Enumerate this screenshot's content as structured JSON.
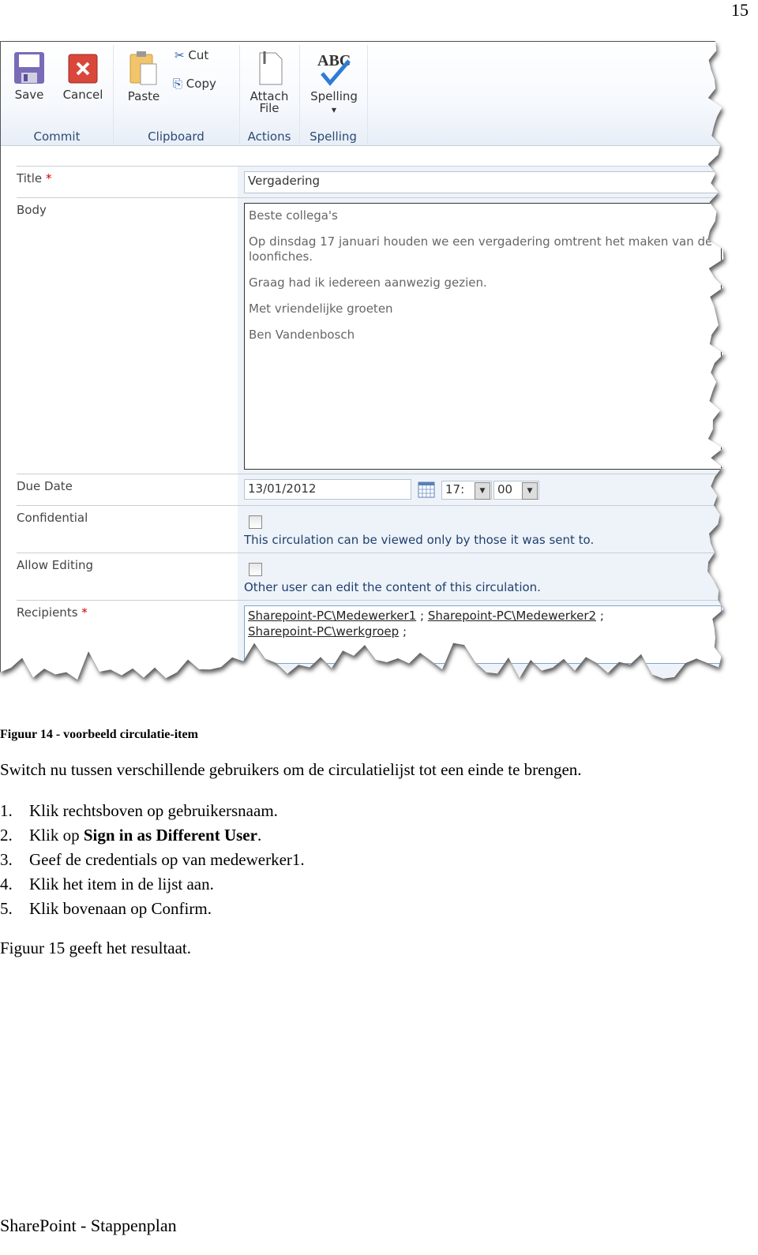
{
  "page_number": "15",
  "screenshot": {
    "ribbon": {
      "groups": [
        {
          "label": "Commit",
          "buttons": [
            "Save",
            "Cancel"
          ]
        },
        {
          "label": "Clipboard",
          "buttons": [
            "Paste",
            "Cut",
            "Copy"
          ]
        },
        {
          "label": "Actions",
          "buttons": [
            "Attach File"
          ]
        },
        {
          "label": "Spelling",
          "buttons": [
            "Spelling"
          ]
        }
      ]
    },
    "form": {
      "title": {
        "label": "Title",
        "required": "*",
        "value": "Vergadering"
      },
      "body": {
        "label": "Body",
        "paragraphs": [
          "Beste collega's",
          "Op dinsdag 17 januari houden we een vergadering omtrent het maken van de loonfiches.",
          "Graag had ik iedereen aanwezig gezien.",
          "Met vriendelijke groeten",
          "Ben Vandenbosch"
        ]
      },
      "due_date": {
        "label": "Due Date",
        "date": "13/01/2012",
        "hour": "17:",
        "minute": "00"
      },
      "confidential": {
        "label": "Confidential",
        "checked": false,
        "hint": "This circulation can be viewed only by those it was sent to."
      },
      "allow_editing": {
        "label": "Allow Editing",
        "checked": false,
        "hint": "Other user can edit the content of this circulation."
      },
      "recipients": {
        "label": "Recipients",
        "required": "*",
        "values": [
          "Sharepoint-PC\\Medewerker1",
          "Sharepoint-PC\\Medewerker2",
          "Sharepoint-PC\\werkgroep"
        ],
        "separator": ";"
      }
    }
  },
  "caption": "Figuur 14 - voorbeeld circulatie-item",
  "intro": "Switch nu tussen verschillende gebruikers om de circulatielijst tot een einde te brengen.",
  "steps": [
    {
      "num": "1.",
      "pre": "Klik rechtsboven op gebruikersnaam.",
      "bold": "",
      "post": ""
    },
    {
      "num": "2.",
      "pre": "Klik op ",
      "bold": "Sign in as Different User",
      "post": "."
    },
    {
      "num": "3.",
      "pre": "Geef de credentials op van medewerker1.",
      "bold": "",
      "post": ""
    },
    {
      "num": "4.",
      "pre": "Klik het item in de lijst aan.",
      "bold": "",
      "post": ""
    },
    {
      "num": "5.",
      "pre": "Klik bovenaan op Confirm.",
      "bold": "",
      "post": ""
    }
  ],
  "outro": "Figuur 15 geeft het resultaat.",
  "footer": "SharePoint - Stappenplan"
}
